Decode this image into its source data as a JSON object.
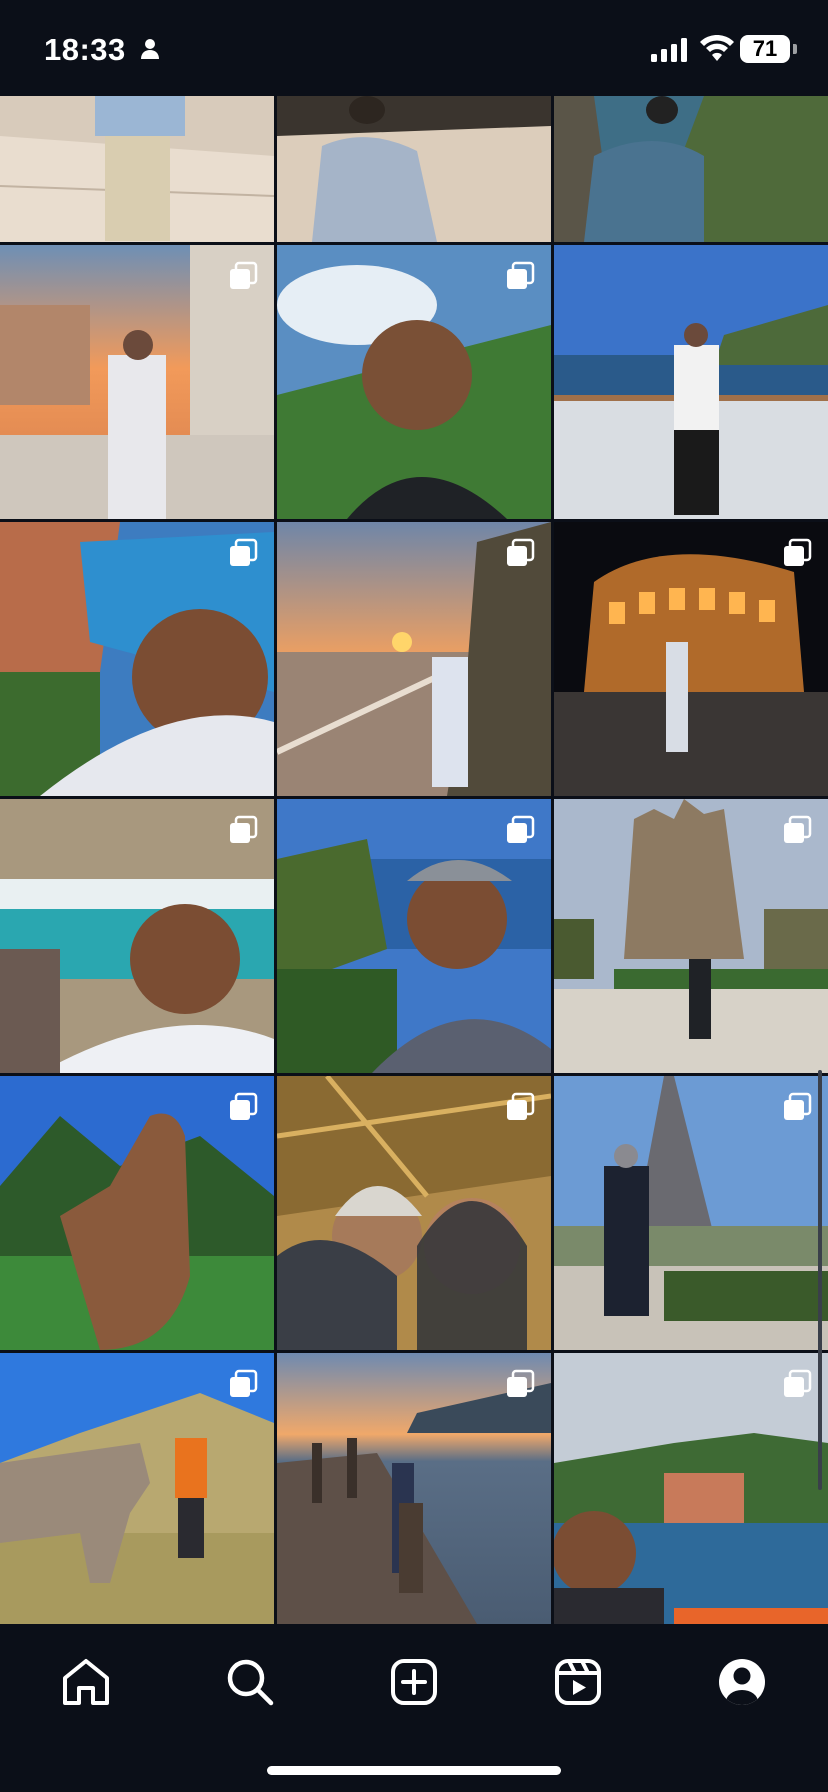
{
  "status_bar": {
    "time": "18:33",
    "battery": "71"
  },
  "grid": {
    "tiles": [
      {
        "name": "photo-marble-hall-standing",
        "multi": false
      },
      {
        "name": "photo-marble-hall-back",
        "multi": false
      },
      {
        "name": "photo-cliff-sea",
        "multi": false
      },
      {
        "name": "photo-venice-bridge-sunset",
        "multi": true
      },
      {
        "name": "photo-selfie-hills",
        "multi": true
      },
      {
        "name": "photo-monaco-harbor",
        "multi": false
      },
      {
        "name": "photo-nice-selfie",
        "multi": true
      },
      {
        "name": "photo-sunset-sea-railing",
        "multi": true
      },
      {
        "name": "photo-colosseum-night",
        "multi": true
      },
      {
        "name": "photo-trevi-fountain-selfie",
        "multi": true
      },
      {
        "name": "photo-coast-selfie-cap",
        "multi": true
      },
      {
        "name": "photo-sagrada-familia",
        "multi": true
      },
      {
        "name": "photo-hand-wave-trees",
        "multi": true
      },
      {
        "name": "photo-eiffel-couple-selfie",
        "multi": true
      },
      {
        "name": "photo-eiffel-tower-standing",
        "multi": true
      },
      {
        "name": "photo-field-animal",
        "multi": true
      },
      {
        "name": "photo-pier-sunset",
        "multi": true
      },
      {
        "name": "photo-cinque-terre",
        "multi": true
      }
    ]
  },
  "tabbar": {
    "items": [
      {
        "name": "tab-home",
        "icon": "home-icon"
      },
      {
        "name": "tab-search",
        "icon": "search-icon"
      },
      {
        "name": "tab-create",
        "icon": "plus-square-icon"
      },
      {
        "name": "tab-reels",
        "icon": "reels-icon"
      },
      {
        "name": "tab-profile",
        "icon": "profile-icon"
      }
    ]
  },
  "colors": {
    "background": "#0b0f18",
    "grid_gap": "#0b0f18",
    "icon": "#ffffff"
  }
}
